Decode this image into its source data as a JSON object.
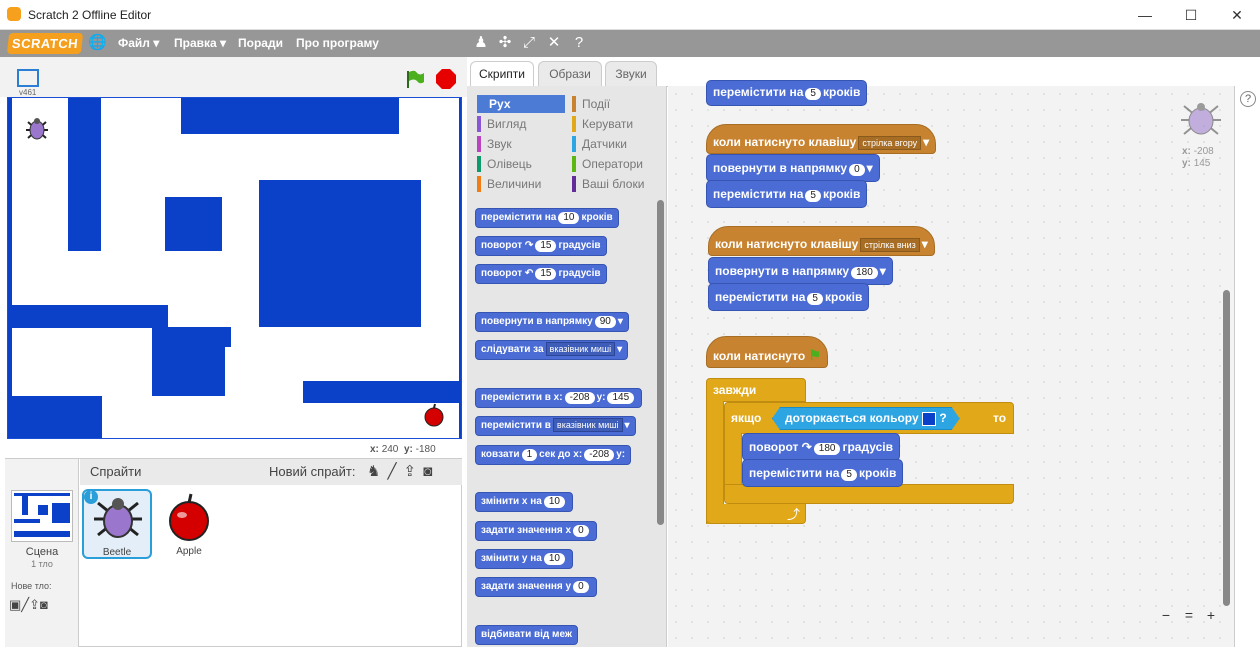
{
  "window": {
    "title": "Scratch 2 Offline Editor",
    "minimize": "—",
    "maximize": "☐",
    "close": "✕"
  },
  "menubar": {
    "logo": "SCRATCH",
    "items": [
      "Файл ▾",
      "Правка ▾",
      "Поради",
      "Про програму"
    ]
  },
  "stage": {
    "version": "v461",
    "coords_x_label": "x:",
    "coords_x": "240",
    "coords_y_label": "y:",
    "coords_y": "-180"
  },
  "sprites": {
    "title": "Спрайти",
    "new_sprite": "Новий спрайт:",
    "stage_label": "Сцена",
    "stage_sub": "1 тло",
    "new_backdrop": "Нове тло:",
    "items": [
      {
        "name": "Beetle"
      },
      {
        "name": "Apple"
      }
    ]
  },
  "tabs": [
    "Скрипти",
    "Образи",
    "Звуки"
  ],
  "categories": {
    "left": [
      {
        "label": "Рух",
        "color": "#4a6cd4"
      },
      {
        "label": "Вигляд",
        "color": "#8a55d7"
      },
      {
        "label": "Звук",
        "color": "#bb42c3"
      },
      {
        "label": "Олівець",
        "color": "#0e9a6c"
      },
      {
        "label": "Величини",
        "color": "#ee7d16"
      }
    ],
    "right": [
      {
        "label": "Події",
        "color": "#c88330"
      },
      {
        "label": "Керувати",
        "color": "#e1a91a"
      },
      {
        "label": "Датчики",
        "color": "#2ca5e2"
      },
      {
        "label": "Оператори",
        "color": "#5cb712"
      },
      {
        "label": "Ваші блоки",
        "color": "#632d99"
      }
    ]
  },
  "palette": {
    "b1": {
      "a": "перемістити на",
      "n": "10",
      "b": "кроків"
    },
    "b2": {
      "a": "поворот",
      "n": "15",
      "b": "градусів"
    },
    "b3": {
      "a": "поворот",
      "n": "15",
      "b": "градусів"
    },
    "b4": {
      "a": "повернути в напрямку",
      "n": "90"
    },
    "b5": {
      "a": "слідувати за",
      "d": "вказівник миші"
    },
    "b6": {
      "a": "перемістити в x:",
      "n": "-208",
      "b": "y:",
      "n2": "145"
    },
    "b7": {
      "a": "перемістити в",
      "d": "вказівник миші"
    },
    "b8": {
      "a": "ковзати",
      "n": "1",
      "b": "сек до x:",
      "n2": "-208",
      "c": "y:"
    },
    "b9": {
      "a": "змінити х на",
      "n": "10"
    },
    "b10": {
      "a": "задати значення х",
      "n": "0"
    },
    "b11": {
      "a": "змінити у на",
      "n": "10"
    },
    "b12": {
      "a": "задати значення у",
      "n": "0"
    },
    "b13": {
      "a": "відбивати від меж"
    }
  },
  "script": {
    "top": {
      "a": "перемістити на",
      "n": "5",
      "b": "кроків"
    },
    "hat_up": {
      "a": "коли натиснуто клавішу",
      "d": "стрілка вгору"
    },
    "up1": {
      "a": "повернути в напрямку",
      "n": "0"
    },
    "up2": {
      "a": "перемістити на",
      "n": "5",
      "b": "кроків"
    },
    "hat_down": {
      "a": "коли натиснуто клавішу",
      "d": "стрілка вниз"
    },
    "dn1": {
      "a": "повернути в напрямку",
      "n": "180"
    },
    "dn2": {
      "a": "перемістити на",
      "n": "5",
      "b": "кроків"
    },
    "hat_flag": {
      "a": "коли натиснуто"
    },
    "forever": "завжди",
    "if": {
      "a": "якщо",
      "sensor": "доторкається кольору",
      "q": "?",
      "b": "то"
    },
    "if1": {
      "a": "поворот",
      "n": "180",
      "b": "градусів"
    },
    "if2": {
      "a": "перемістити на",
      "n": "5",
      "b": "кроків"
    }
  },
  "sprite_info": {
    "x_label": "x:",
    "x": "-208",
    "y_label": "y:",
    "y": "145"
  },
  "zoom": {
    "out": "−",
    "reset": "=",
    "in": "+"
  },
  "help": "?"
}
